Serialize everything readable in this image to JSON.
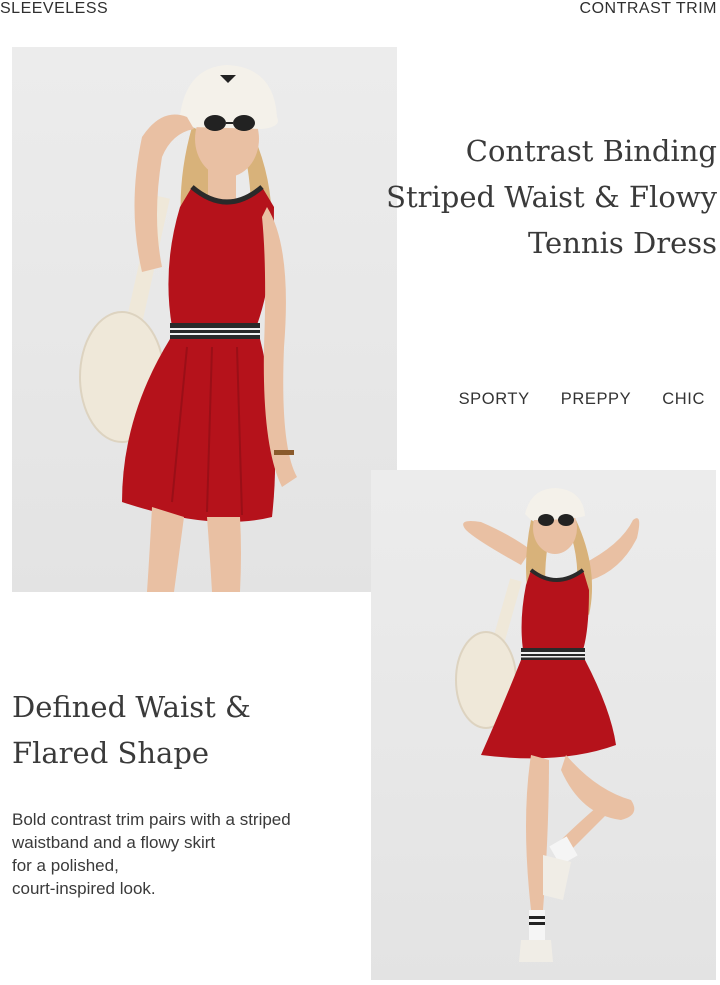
{
  "header": {
    "left_label": "SLEEVELESS",
    "right_label": "CONTRAST TRIM"
  },
  "headline": {
    "lines": [
      "Contrast Binding",
      "Striped Waist & Flowy",
      "Tennis Dress"
    ]
  },
  "tags": [
    "SPORTY",
    "PREPPY",
    "CHIC"
  ],
  "feature": {
    "heading_lines": [
      "Defined Waist &",
      "Flared Shape"
    ],
    "body_lines": [
      "Bold contrast trim pairs with a striped",
      "waistband and a flowy skirt",
      "for a polished,",
      "court-inspired look."
    ]
  },
  "colors": {
    "dress_red": "#b5121b",
    "trim_black": "#2a2a2a",
    "bag_cream": "#efe8d9",
    "hat_white": "#f4f1ea",
    "skin": "#e9c0a3",
    "hair": "#d8b27a",
    "background": "#ffffff"
  },
  "images": {
    "photo_1": "model-standing-hand-on-hat",
    "photo_2": "model-posing-leg-raised"
  }
}
